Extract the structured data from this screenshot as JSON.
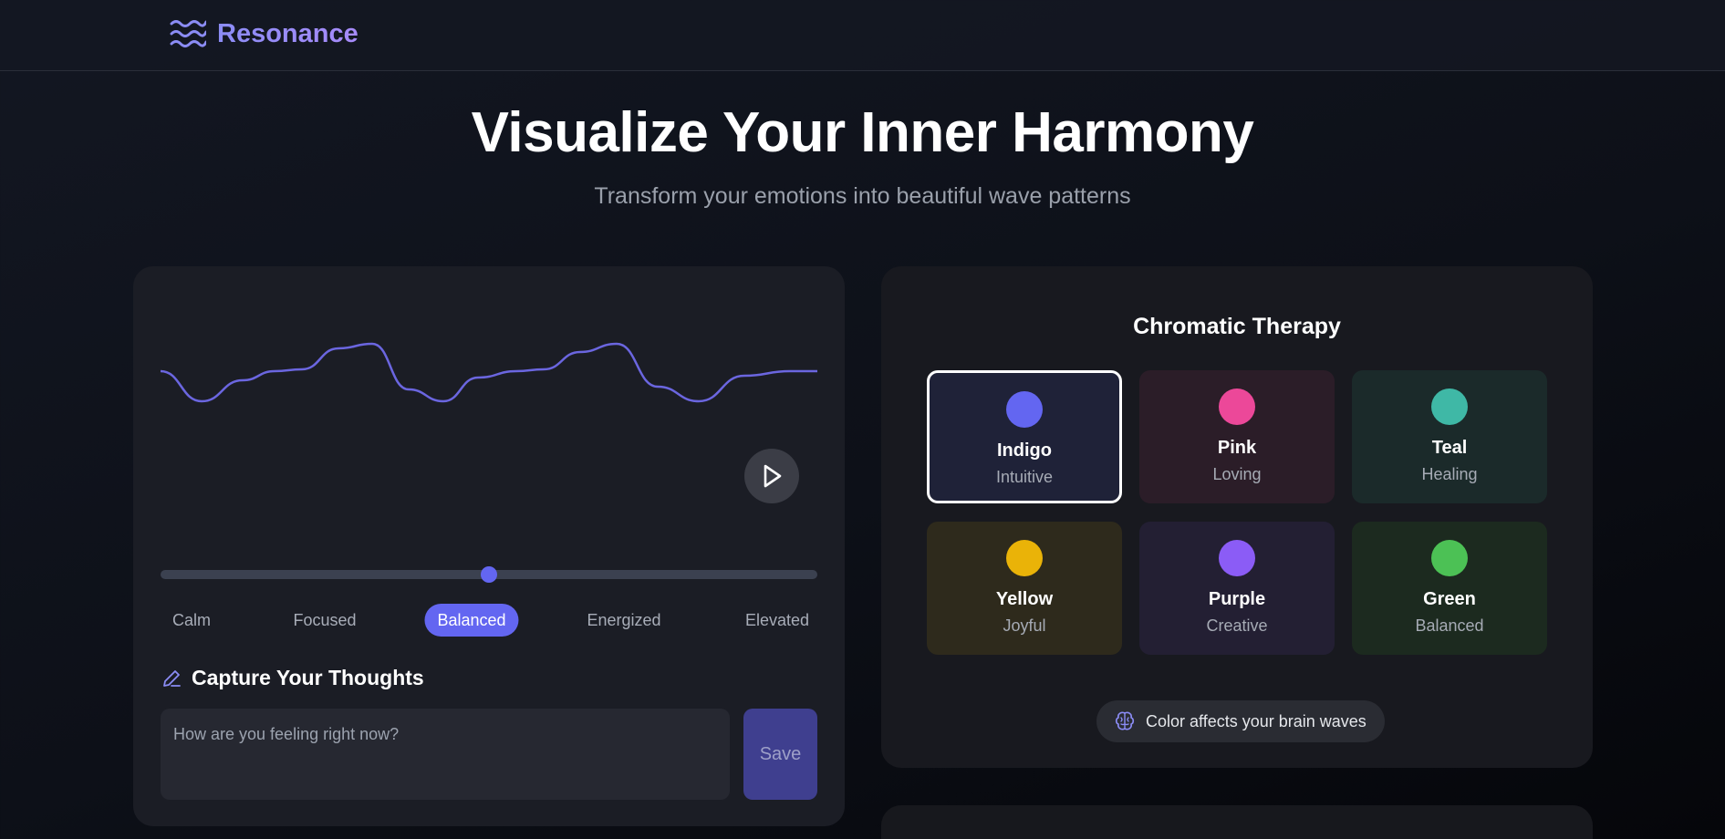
{
  "header": {
    "brand": "Resonance"
  },
  "hero": {
    "title": "Visualize Your Inner Harmony",
    "subtitle": "Transform your emotions into beautiful wave patterns"
  },
  "wave_panel": {
    "slider_value_fraction": 0.5,
    "moods": [
      "Calm",
      "Focused",
      "Balanced",
      "Energized",
      "Elevated"
    ],
    "selected_mood": "Balanced",
    "capture_title": "Capture Your Thoughts",
    "input_placeholder": "How are you feeling right now?",
    "save_label": "Save"
  },
  "chromatic": {
    "title": "Chromatic Therapy",
    "colors": [
      {
        "name": "Indigo",
        "mood": "Intuitive",
        "color": "#6366f1",
        "bg": "#1f2238",
        "selected": true
      },
      {
        "name": "Pink",
        "mood": "Loving",
        "color": "#ec4899",
        "bg": "#2b1d28",
        "selected": false
      },
      {
        "name": "Teal",
        "mood": "Healing",
        "color": "#3fb8a6",
        "bg": "#1b2a2a",
        "selected": false
      },
      {
        "name": "Yellow",
        "mood": "Joyful",
        "color": "#eab308",
        "bg": "#2e2a1c",
        "selected": false
      },
      {
        "name": "Purple",
        "mood": "Creative",
        "color": "#8b5cf6",
        "bg": "#231f33",
        "selected": false
      },
      {
        "name": "Green",
        "mood": "Balanced",
        "color": "#4cc155",
        "bg": "#1c2a1f",
        "selected": false
      }
    ],
    "footer_note": "Color affects your brain waves"
  },
  "colors": {
    "accent": "#6366f1",
    "wave_stroke": "#6b66e0"
  }
}
